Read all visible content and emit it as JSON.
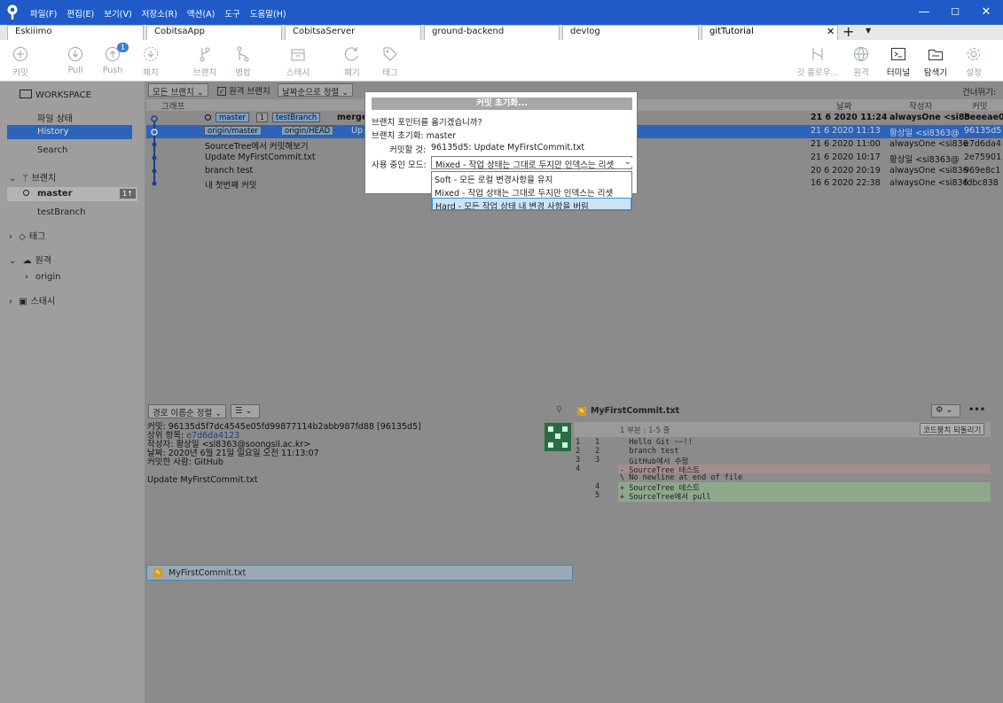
{
  "menu": [
    "파일(F)",
    "편집(E)",
    "보기(V)",
    "저장소(R)",
    "액션(A)",
    "도구",
    "도움말(H)"
  ],
  "window_controls": {
    "minimize": "—",
    "maximize": "☐",
    "close": "✕"
  },
  "tabs": [
    "Eskiiimo",
    "CobitsaApp",
    "CobitsaServer",
    "ground-backend",
    "devlog",
    "gitTutorial"
  ],
  "tab_close": "✕",
  "tab_add": "+",
  "toolbar": {
    "left": [
      "커밋",
      "Pull",
      "Push",
      "패치",
      "브랜치",
      "병합",
      "스태시",
      "폐기",
      "태그"
    ],
    "push_badge": "1",
    "right": [
      "깃 플로우...",
      "원격",
      "터미널",
      "탐색기",
      "설정"
    ]
  },
  "sidebar": {
    "workspace": "WORKSPACE",
    "items": [
      "파일 상태",
      "History",
      "Search"
    ],
    "branches": "브랜치",
    "branch_items": [
      "master",
      "testBranch"
    ],
    "master_badge": "1↑",
    "tags": "태그",
    "remotes": "원격",
    "remote_items": [
      "origin"
    ],
    "stash": "스태시"
  },
  "filters": {
    "branches": "모든 브랜치",
    "remote": "원격 브랜치",
    "sort": "날짜순으로 정렬",
    "skip": "건너뛰기:"
  },
  "columns": {
    "graph": "그래프",
    "date": "날짜",
    "author": "작성자",
    "commit": "커밋"
  },
  "commits": [
    {
      "tags": [
        "master",
        "1",
        "testBranch"
      ],
      "desc": "merge",
      "date": "21 6 2020 11:24",
      "author": "alwaysOne <si83",
      "hash": "beeeae0"
    },
    {
      "tags": [
        "origin/master",
        "origin/HEAD"
      ],
      "desc": "Up",
      "date": "21 6 2020 11:13",
      "author": "황상일 <si8363@",
      "hash": "96135d5"
    },
    {
      "tags": [],
      "desc": "SourceTree에서 커밋해보기",
      "date": "21 6 2020 11:00",
      "author": "alwaysOne <si836",
      "hash": "e7d6da4"
    },
    {
      "tags": [],
      "desc": "Update MyFirstCommit.txt",
      "date": "21 6 2020 10:17",
      "author": "황상일 <si8363@",
      "hash": "2e75901"
    },
    {
      "tags": [],
      "desc": "branch test",
      "date": "20 6 2020 20:19",
      "author": "alwaysOne <si836",
      "hash": "969e8c1"
    },
    {
      "tags": [],
      "desc": "내 첫번째 커밋",
      "date": "16 6 2020 22:38",
      "author": "alwaysOne <si836",
      "hash": "fdbc838"
    }
  ],
  "detail": {
    "sort": "경로 이름순 정렬",
    "commit": "커밋: 96135d5f7dc4545e05fd99877114b2abb987fd88 [96135d5]",
    "parent_label": "상위 항목: ",
    "parent": "e7d6da4123",
    "author": "작성자: 황상일 <si8363@soongsil.ac.kr>",
    "date": "날짜: 2020년 6월 21일 일요일 오전 11:13:07",
    "committer": "커밋한 사람: GitHub",
    "message": "Update MyFirstCommit.txt",
    "file": "MyFirstCommit.txt"
  },
  "diff": {
    "file": "MyFirstCommit.txt",
    "hunk": "1 부분 : 1-5 줄",
    "revert": "코드뭉치 되돌리기",
    "lines": [
      {
        "o": "1",
        "n": "1",
        "t": "  Hello Git ~~!!",
        "k": "ctx"
      },
      {
        "o": "2",
        "n": "2",
        "t": "  branch test",
        "k": "ctx"
      },
      {
        "o": "3",
        "n": "3",
        "t": "  GitHub에서 수정",
        "k": "ctx"
      },
      {
        "o": "4",
        "n": "",
        "t": "- SourceTree 테스트",
        "k": "del"
      },
      {
        "o": "",
        "n": "",
        "t": "\\ No newline at end of file",
        "k": "ctx"
      },
      {
        "o": "",
        "n": "4",
        "t": "+ SourceTree 테스트",
        "k": "add"
      },
      {
        "o": "",
        "n": "5",
        "t": "+ SourceTree에서 pull",
        "k": "add"
      }
    ]
  },
  "dialog": {
    "title": "커밋 초기화...",
    "question": "브랜치 포인터를 옮기겠습니까?",
    "branch": "브랜치 초기화: master",
    "target_label": "커밋할 것:",
    "target": "96135d5: Update MyFirstCommit.txt",
    "mode_label": "사용 중인 모드:",
    "mode_value": "Mixed - 작업 상태는 그대로 두지만 인덱스는 리셋",
    "options": [
      "Soft - 모든 로컬 변경사항을 유지",
      "Mixed - 작업 상태는 그대로 두지만 인덱스는 리셋",
      "Hard - 모든 작업 상태 내 변경 사항을 버림"
    ]
  }
}
